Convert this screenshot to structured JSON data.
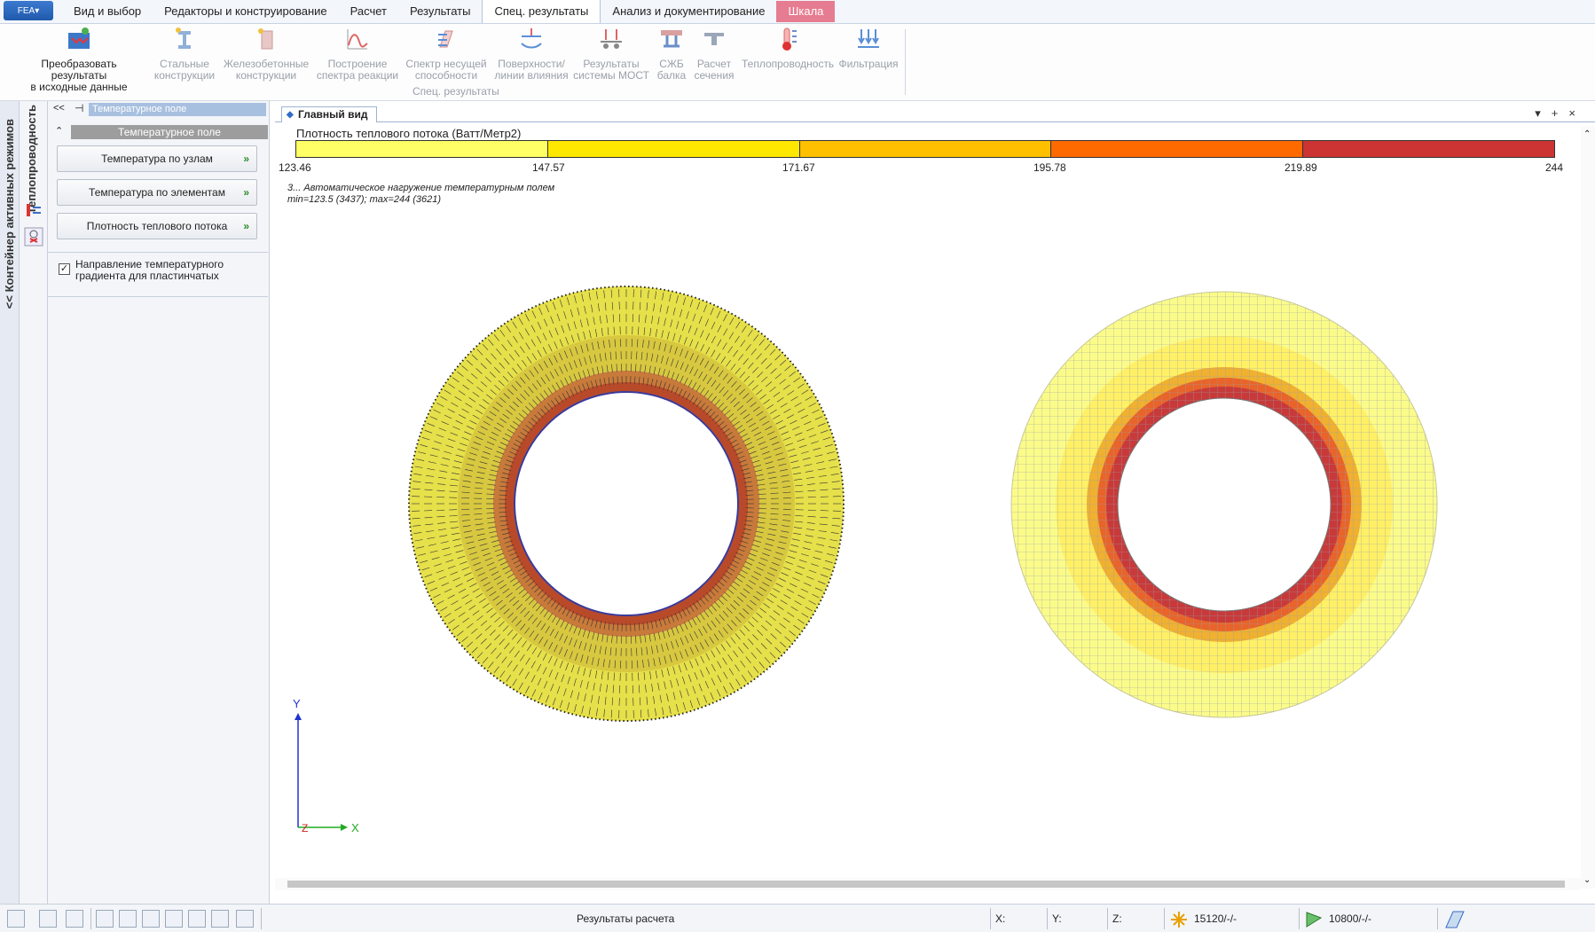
{
  "menu": {
    "app_button": "FEA",
    "tabs": [
      {
        "label": "Вид и выбор"
      },
      {
        "label": "Редакторы и конструирование"
      },
      {
        "label": "Расчет"
      },
      {
        "label": "Результаты"
      },
      {
        "label": "Спец. результаты"
      },
      {
        "label": "Анализ и документирование"
      },
      {
        "label": "Шкала"
      }
    ]
  },
  "ribbon": {
    "items": [
      {
        "l1": "Преобразовать результаты",
        "l2": "в исходные данные"
      },
      {
        "l1": "Стальные",
        "l2": "конструкции"
      },
      {
        "l1": "Железобетонные",
        "l2": "конструкции"
      },
      {
        "l1": "Построение",
        "l2": "спектра реакции"
      },
      {
        "l1": "Спектр несущей",
        "l2": "способности"
      },
      {
        "l1": "Поверхности/",
        "l2": "линии влияния"
      },
      {
        "l1": "Результаты",
        "l2": "системы МОСТ"
      },
      {
        "l1": "СЖБ",
        "l2": "балка"
      },
      {
        "l1": "Расчет",
        "l2": "сечения"
      },
      {
        "l1": "Теплопроводность",
        "l2": ""
      },
      {
        "l1": "Фильтрация",
        "l2": ""
      }
    ],
    "group_label": "Спец. результаты"
  },
  "left": {
    "container_label": "<< Контейнер активных режимов",
    "mode_label": "Теплопроводность"
  },
  "panel": {
    "title": "Температурное поле",
    "subtitle": "Температурное поле",
    "buttons": [
      {
        "label": "Температура по узлам"
      },
      {
        "label": "Температура по элементам"
      },
      {
        "label": "Плотность теплового потока"
      }
    ],
    "arrow": "»",
    "checkbox_line1": "Направление температурного",
    "checkbox_line2": "градиента для пластинчатых",
    "checkbox_checked": true
  },
  "view": {
    "tab_label": "Главный вид",
    "legend_title": "Плотность теплового потока (Ватт/Метр2)",
    "scale_colors": [
      "#ffff66",
      "#ffe800",
      "#ffc000",
      "#ff6a00",
      "#cc3333"
    ],
    "ticks": [
      "123.46",
      "147.57",
      "171.67",
      "195.78",
      "219.89",
      "244"
    ],
    "info_line1": "3... Автоматическое нагружение температурным полем",
    "info_line2": "min=123.5 (3437); max=244 (3621)",
    "axis_y": "Y",
    "axis_x": "X",
    "axis_z": "Z"
  },
  "status": {
    "center_text": "Результаты расчета",
    "x_label": "X:",
    "y_label": "Y:",
    "z_label": "Z:",
    "nodes": "15120/-/-",
    "elements": "10800/-/-"
  }
}
